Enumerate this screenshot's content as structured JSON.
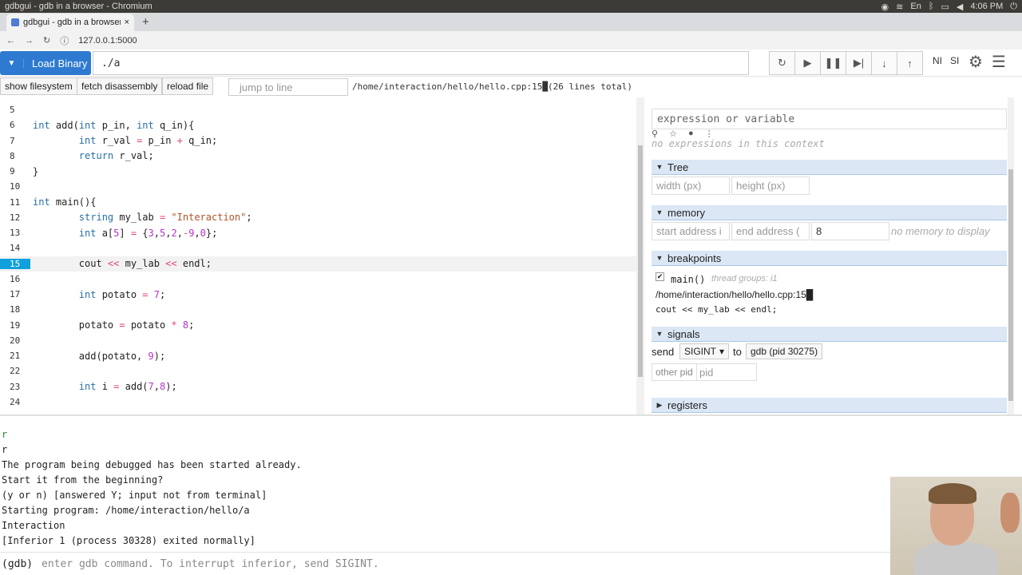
{
  "window": {
    "title": "gdbgui - gdb in a browser - Chromium",
    "clock": "4:06 PM",
    "tray_lang": "En"
  },
  "browser": {
    "tab_title": "gdbgui - gdb in a browser",
    "url": "127.0.0.1:5000"
  },
  "toolbar": {
    "load_binary_label": "Load Binary",
    "binary_path": "./a",
    "ni_label": "NI",
    "si_label": "SI"
  },
  "toolbar2": {
    "show_filesystem": "show filesystem",
    "fetch_disassembly": "fetch disassembly",
    "reload_file": "reload file",
    "jump_placeholder": "jump to line",
    "file_info": "/home/interaction/hello/hello.cpp:15█(26 lines total)"
  },
  "code": {
    "lines": [
      {
        "n": "5",
        "html": ""
      },
      {
        "n": "6",
        "html": "<span class=\"kw\">int</span> add(<span class=\"kw\">int</span> p_in, <span class=\"kw\">int</span> q_in){"
      },
      {
        "n": "7",
        "html": "        <span class=\"kw\">int</span> r_val <span class=\"op\">=</span> p_in <span class=\"op\">+</span> q_in;"
      },
      {
        "n": "8",
        "html": "        <span class=\"kw\">return</span> r_val;"
      },
      {
        "n": "9",
        "html": "}"
      },
      {
        "n": "10",
        "html": ""
      },
      {
        "n": "11",
        "html": "<span class=\"kw\">int</span> main(){"
      },
      {
        "n": "12",
        "html": "        <span class=\"kw\">string</span> my_lab <span class=\"op\">=</span> <span class=\"str\">\"Interaction\"</span>;"
      },
      {
        "n": "13",
        "html": "        <span class=\"kw\">int</span> a[<span class=\"num\">5</span>] <span class=\"op\">=</span> {<span class=\"num\">3</span>,<span class=\"num\">5</span>,<span class=\"num\">2</span>,<span class=\"op\">-</span><span class=\"num\">9</span>,<span class=\"num\">0</span>};"
      },
      {
        "n": "14",
        "html": ""
      },
      {
        "n": "15",
        "html": "        cout <span class=\"op\">&lt;&lt;</span> my_lab <span class=\"op\">&lt;&lt;</span> endl;"
      },
      {
        "n": "16",
        "html": ""
      },
      {
        "n": "17",
        "html": "        <span class=\"kw\">int</span> potato <span class=\"op\">=</span> <span class=\"num\">7</span>;"
      },
      {
        "n": "18",
        "html": ""
      },
      {
        "n": "19",
        "html": "        potato <span class=\"op\">=</span> potato <span class=\"op\">*</span> <span class=\"num\">8</span>;"
      },
      {
        "n": "20",
        "html": ""
      },
      {
        "n": "21",
        "html": "        add(potato, <span class=\"num\">9</span>);"
      },
      {
        "n": "22",
        "html": ""
      },
      {
        "n": "23",
        "html": "        <span class=\"kw\">int</span> i <span class=\"op\">=</span> add(<span class=\"num\">7</span>,<span class=\"num\">8</span>);"
      },
      {
        "n": "24",
        "html": ""
      }
    ],
    "active_line": "15"
  },
  "sidebar": {
    "expr_placeholder": "expression or variable",
    "no_expressions": "no expressions in this context",
    "tree_title": "Tree",
    "tree_width_placeholder": "width (px)",
    "tree_height_placeholder": "height (px)",
    "memory_title": "memory",
    "mem_start_placeholder": "start address i",
    "mem_end_placeholder": "end address (",
    "mem_count": "8",
    "no_memory": "no memory to display",
    "breakpoints_title": "breakpoints",
    "bp_func": "main()",
    "bp_thread_groups": "thread groups: i1",
    "bp_path": "/home/interaction/hello/hello.cpp:15█",
    "bp_code": "cout << my_lab << endl;",
    "signals_title": "signals",
    "signals_send": "send",
    "signal_value": "SIGINT",
    "signals_to": "to",
    "signal_target": "gdb (pid 30275)",
    "other_pid_label": "other pid",
    "pid_placeholder": "pid",
    "registers_title": "registers"
  },
  "console": {
    "lines": [
      {
        "text": "r",
        "green": true
      },
      {
        "text": "r",
        "green": false
      },
      {
        "text": "The program being debugged has been started already.",
        "green": false
      },
      {
        "text": "Start it from the beginning?",
        "green": false
      },
      {
        "text": "(y or n) [answered Y; input not from terminal]",
        "green": false
      },
      {
        "text": "Starting program: /home/interaction/hello/a",
        "green": false
      },
      {
        "text": "Interaction",
        "green": false
      },
      {
        "text": "[Inferior 1 (process 30328) exited normally]",
        "green": false
      }
    ],
    "prompt": "(gdb)",
    "input_placeholder": "enter gdb command. To interrupt inferior, send SIGINT."
  }
}
